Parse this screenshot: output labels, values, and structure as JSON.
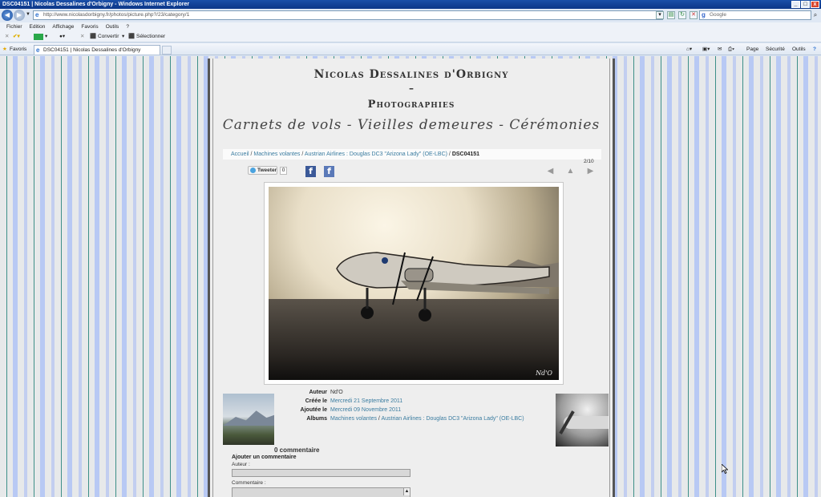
{
  "window": {
    "title": "DSC04151 | Nicolas Dessalines d'Orbigny - Windows Internet Explorer",
    "buttons": {
      "minimize": "_",
      "maximize": "□",
      "close": "x"
    }
  },
  "address": {
    "url": "http://www.nicolasdorbigny.fr/photos/picture.php?/23/category/1"
  },
  "search": {
    "placeholder": "Google",
    "engine_icon": "g-icon"
  },
  "menu": {
    "items": [
      "Fichier",
      "Edition",
      "Affichage",
      "Favoris",
      "Outils",
      "?"
    ]
  },
  "commandbar": {
    "convert_label": "Convertir",
    "select_label": "Sélectionner"
  },
  "favorites": {
    "label": "Favoris",
    "tab_title": "DSC04151 | Nicolas Dessalines d'Orbigny",
    "right_items": [
      "Page",
      "Sécurité",
      "Outils"
    ]
  },
  "site": {
    "title": "Nicolas Dessalines d'Orbigny",
    "dash": "–",
    "subtitle": "Photographies",
    "tagline": "Carnets de vols - Vieilles demeures - Cérémonies"
  },
  "breadcrumb": {
    "home": "Accueil",
    "cat1": "Machines volantes",
    "cat2": "Austrian Airlines : Douglas DC3 \"Arizona Lady\" (OE-LBC)",
    "current": "DSC04151",
    "sep": " / "
  },
  "counter": "2/10",
  "social": {
    "tweet_label": "Tweeter",
    "tweet_count": "0",
    "fb1": "f",
    "fb2": "f"
  },
  "nav_icons": {
    "prev": "◀",
    "up": "▲",
    "next": "▶"
  },
  "photo": {
    "signature": "Nd'O"
  },
  "meta": {
    "author_label": "Auteur",
    "author_value": "Nd'O",
    "created_label": "Créée le",
    "created_value": "Mercredi 21 Septembre 2011",
    "added_label": "Ajoutée le",
    "added_value": "Mercredi 09 Novembre 2011",
    "albums_label": "Albums",
    "album1": "Machines volantes",
    "album_sep": " / ",
    "album2": "Austrian Airlines : Douglas DC3 \"Arizona Lady\" (OE-LBC)"
  },
  "comments": {
    "count_label": "0 commentaire",
    "add_label": "Ajouter un commentaire",
    "author_field_label": "Auteur :",
    "comment_field_label": "Commentaire :"
  }
}
